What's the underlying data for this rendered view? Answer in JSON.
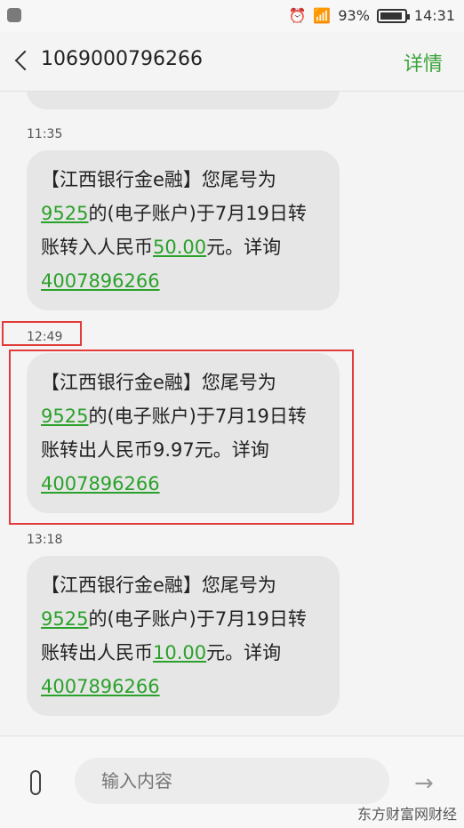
{
  "status_bar": {
    "battery": "93%",
    "time": "14:31",
    "battery_level": 0.93,
    "icons": [
      "alarm-icon",
      "signal-icon",
      "battery-icon"
    ]
  },
  "header": {
    "title": "1069000796266",
    "details_label": "详情"
  },
  "messages": [
    {
      "time": "11:35",
      "lines": [
        [
          {
            "t": "【江西银行金e融】您尾号为"
          }
        ],
        [
          {
            "t": "9525",
            "link": true
          },
          {
            "t": "的(电子账户)于7月19日转"
          }
        ],
        [
          {
            "t": "账转入人民币"
          },
          {
            "t": "50.00",
            "link": true
          },
          {
            "t": "元。详询"
          }
        ],
        [
          {
            "t": "4007896266",
            "link": true
          }
        ]
      ]
    },
    {
      "time": "12:49",
      "lines": [
        [
          {
            "t": "【江西银行金e融】您尾号为"
          }
        ],
        [
          {
            "t": "9525",
            "link": true
          },
          {
            "t": "的(电子账户)于7月19日转"
          }
        ],
        [
          {
            "t": "账转出人民币9.97元。详询"
          }
        ],
        [
          {
            "t": "4007896266",
            "link": true
          }
        ]
      ]
    },
    {
      "time": "13:18",
      "lines": [
        [
          {
            "t": "【江西银行金e融】您尾号为"
          }
        ],
        [
          {
            "t": "9525",
            "link": true
          },
          {
            "t": "的(电子账户)于7月19日转"
          }
        ],
        [
          {
            "t": "账转出人民币"
          },
          {
            "t": "10.00",
            "link": true
          },
          {
            "t": "元。详询"
          }
        ],
        [
          {
            "t": "4007896266",
            "link": true
          }
        ]
      ]
    }
  ],
  "composer": {
    "placeholder": "输入内容"
  },
  "watermark": "东方财富网财经",
  "colors": {
    "accent": "#3aa33a",
    "link": "#2aa12a",
    "highlight": "#e33b3b"
  }
}
